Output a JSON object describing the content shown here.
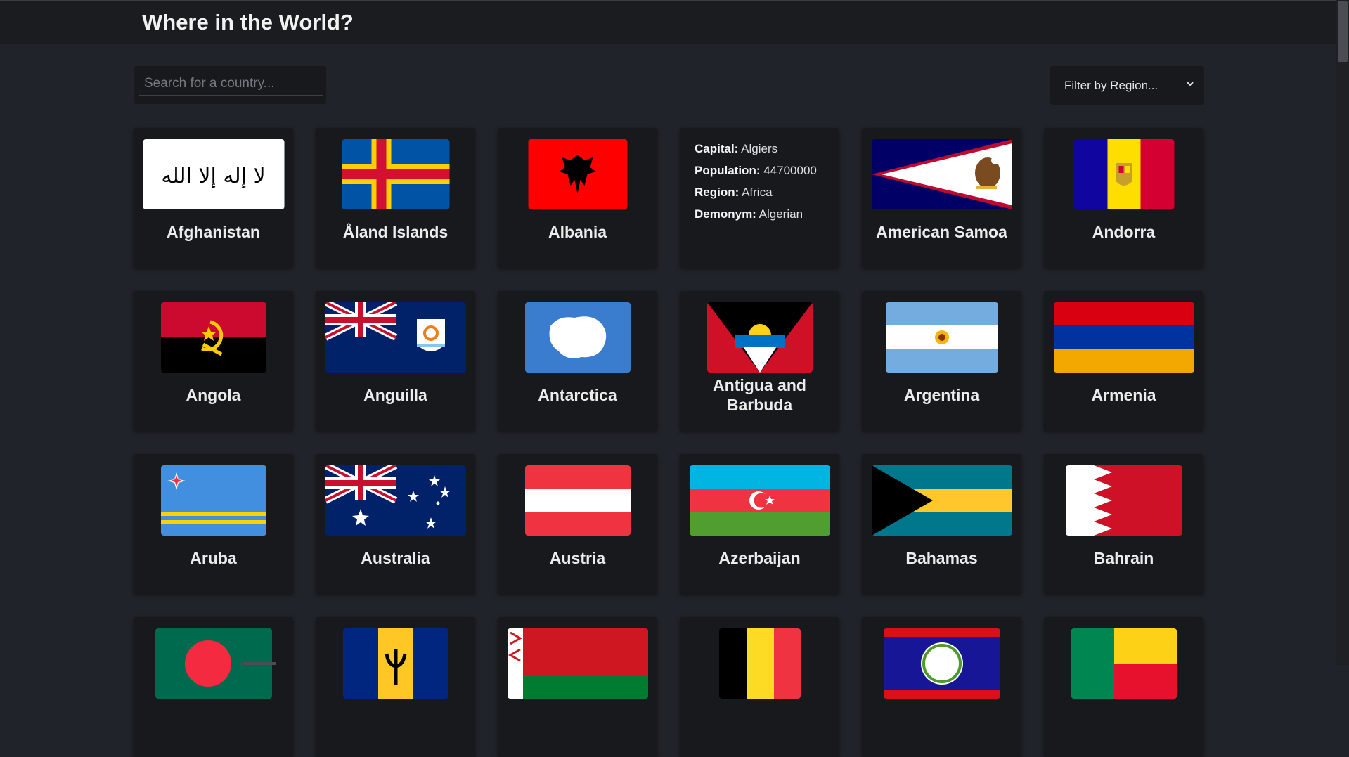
{
  "header": {
    "title": "Where in the World?"
  },
  "search": {
    "placeholder": "Search for a country..."
  },
  "filter": {
    "selected": "Filter by Region..."
  },
  "hover_card": {
    "capital_label": "Capital:",
    "capital": "Algiers",
    "population_label": "Population:",
    "population": "44700000",
    "region_label": "Region:",
    "region": "Africa",
    "demonym_label": "Demonym:",
    "demonym": "Algerian"
  },
  "countries": [
    "Afghanistan",
    "Åland Islands",
    "Albania",
    "",
    "American Samoa",
    "Andorra",
    "Angola",
    "Anguilla",
    "Antarctica",
    "Antigua and Barbuda",
    "Argentina",
    "Armenia",
    "Aruba",
    "Australia",
    "Austria",
    "Azerbaijan",
    "Bahamas",
    "Bahrain",
    "",
    "",
    "",
    "",
    "",
    ""
  ],
  "flag_icons": [
    "afghanistan-flag-icon",
    "aland-flag-icon",
    "albania-flag-icon",
    "",
    "american-samoa-flag-icon",
    "andorra-flag-icon",
    "angola-flag-icon",
    "anguilla-flag-icon",
    "antarctica-flag-icon",
    "antigua-flag-icon",
    "argentina-flag-icon",
    "armenia-flag-icon",
    "aruba-flag-icon",
    "australia-flag-icon",
    "austria-flag-icon",
    "azerbaijan-flag-icon",
    "bahamas-flag-icon",
    "bahrain-flag-icon",
    "bangladesh-flag-icon",
    "barbados-flag-icon",
    "belarus-flag-icon",
    "belgium-flag-icon",
    "belize-flag-icon",
    "benin-flag-icon"
  ],
  "colors": {
    "background": "#202329",
    "card": "#17191d",
    "header": "#1a1c20",
    "text": "#f0f0f0"
  }
}
